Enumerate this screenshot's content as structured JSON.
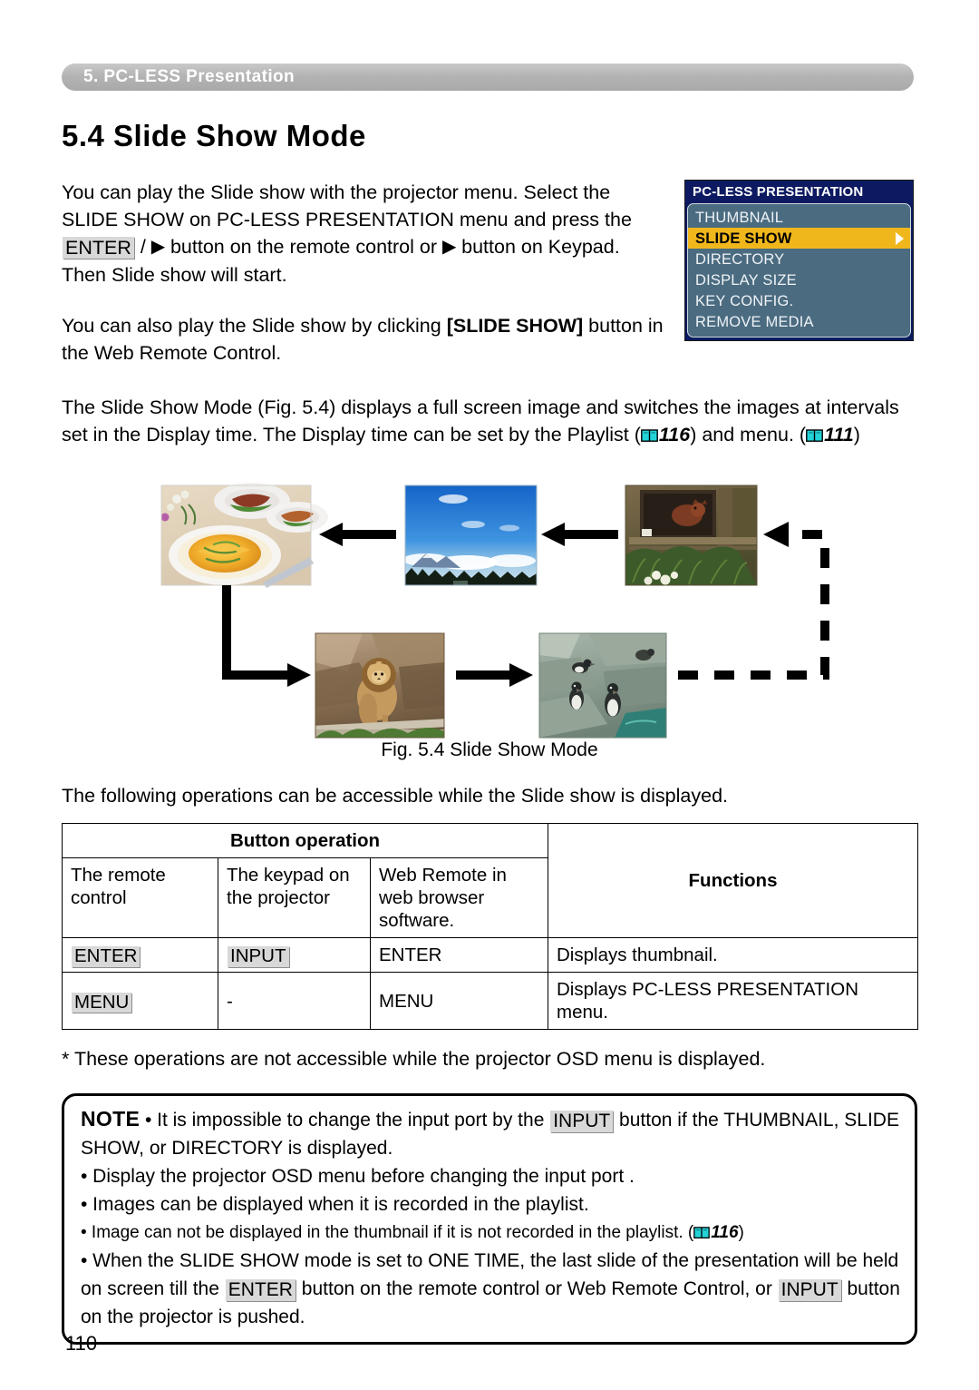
{
  "header": {
    "chapter_label": "5. PC-LESS Presentation"
  },
  "section": {
    "title": "5.4 Slide Show Mode"
  },
  "paragraphs": {
    "p1_a": "You can play the Slide show with the projector menu. Select the SLIDE SHOW on PC-LESS PRESENTATION menu and press the ",
    "p1_key_enter": "ENTER",
    "p1_b": " / ",
    "p1_tri": "▶",
    "p1_c": " button on the remote control or ",
    "p1_d": " button on Keypad. Then Slide show will start.",
    "p2_a": "You can also play the Slide show by clicking ",
    "p2_bold": "[SLIDE SHOW]",
    "p2_b": " button in the Web Remote Control.",
    "p3_a": "The Slide Show Mode (Fig. 5.4) displays a full screen image and switches the images at intervals set in the Display time. The Display time can be set by the Playlist (",
    "p3_ref1": "116",
    "p3_b": ") and menu. (",
    "p3_ref2": "111",
    "p3_c": ")",
    "p4": "The following operations can be accessible while the Slide show is displayed.",
    "p5": "* These operations are not accessible while the projector OSD menu is displayed."
  },
  "osd_menu": {
    "title": "PC-LESS PRESENTATION",
    "items": [
      {
        "label": "THUMBNAIL",
        "selected": false
      },
      {
        "label": "SLIDE SHOW",
        "selected": true
      },
      {
        "label": "DIRECTORY",
        "selected": false
      },
      {
        "label": "DISPLAY SIZE",
        "selected": false
      },
      {
        "label": "KEY CONFIG.",
        "selected": false
      },
      {
        "label": "REMOVE MEDIA",
        "selected": false
      }
    ],
    "colors": {
      "title_bg": "#0d1a61",
      "body_bg": "#4b6b80",
      "selected_bg": "#f0b71c",
      "text": "#eef3f7"
    }
  },
  "figure": {
    "caption": "Fig. 5.4 Slide Show Mode",
    "slides": [
      {
        "name": "food-dessert-photo"
      },
      {
        "name": "sky-mountain-photo"
      },
      {
        "name": "red-panda-photo"
      },
      {
        "name": "lion-photo"
      },
      {
        "name": "penguins-photo"
      }
    ]
  },
  "table": {
    "group_header": "Button operation",
    "functions_header": "Functions",
    "columns": [
      "The remote control",
      "The keypad on the projector",
      "Web Remote in web browser software."
    ],
    "rows": [
      {
        "remote": "ENTER",
        "remote_is_key": true,
        "keypad": "INPUT",
        "keypad_is_key": true,
        "web": "ENTER",
        "function": "Displays thumbnail."
      },
      {
        "remote": "MENU",
        "remote_is_key": true,
        "keypad": "-",
        "keypad_is_key": false,
        "web": "MENU",
        "function": "Displays PC-LESS PRESENTATION menu."
      }
    ]
  },
  "note": {
    "label": "NOTE",
    "l1_a": "• It is impossible to change the input port by the ",
    "l1_key": "INPUT",
    "l1_b": " button if the THUMBNAIL, SLIDE SHOW, or DIRECTORY is displayed.",
    "l2": "• Display the projector OSD menu before changing the input port .",
    "l3": "• Images can be displayed when it is recorded in the playlist.",
    "l4_a": "• Image can not be displayed in the thumbnail if it is not recorded in the playlist. (",
    "l4_ref": "116",
    "l4_b": ")",
    "l5_a": "• When the SLIDE SHOW mode is set to ONE TIME, the last slide of the presentation will be held on screen till the ",
    "l5_key1": "ENTER",
    "l5_b": " button on the remote control or Web Remote Control, or ",
    "l5_key2": "INPUT",
    "l5_c": " button on the projector is pushed."
  },
  "footer": {
    "page_number": "110"
  }
}
